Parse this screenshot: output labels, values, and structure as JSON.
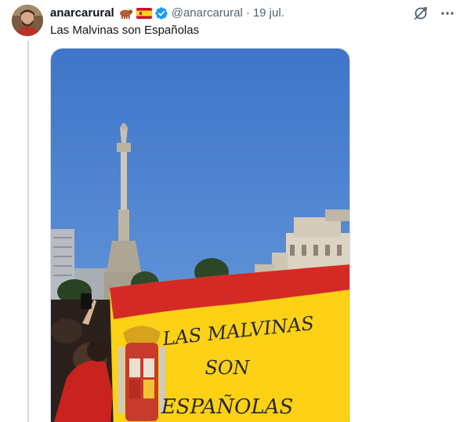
{
  "tweet": {
    "display_name": "anarcarural",
    "name_emojis": [
      "ox-emoji",
      "spain-flag-emoji"
    ],
    "handle": "@anarcarural",
    "separator": "·",
    "date": "19 jul.",
    "text": "Las Malvinas son Españolas",
    "verified_color": "#1d9bf0",
    "icons": [
      "grok-icon",
      "more-icon"
    ],
    "media": {
      "subject": "photo-crowd-spanish-flag",
      "flag_text": [
        "LAS MALVINAS",
        "SON",
        "ESPAÑOLAS"
      ]
    }
  }
}
